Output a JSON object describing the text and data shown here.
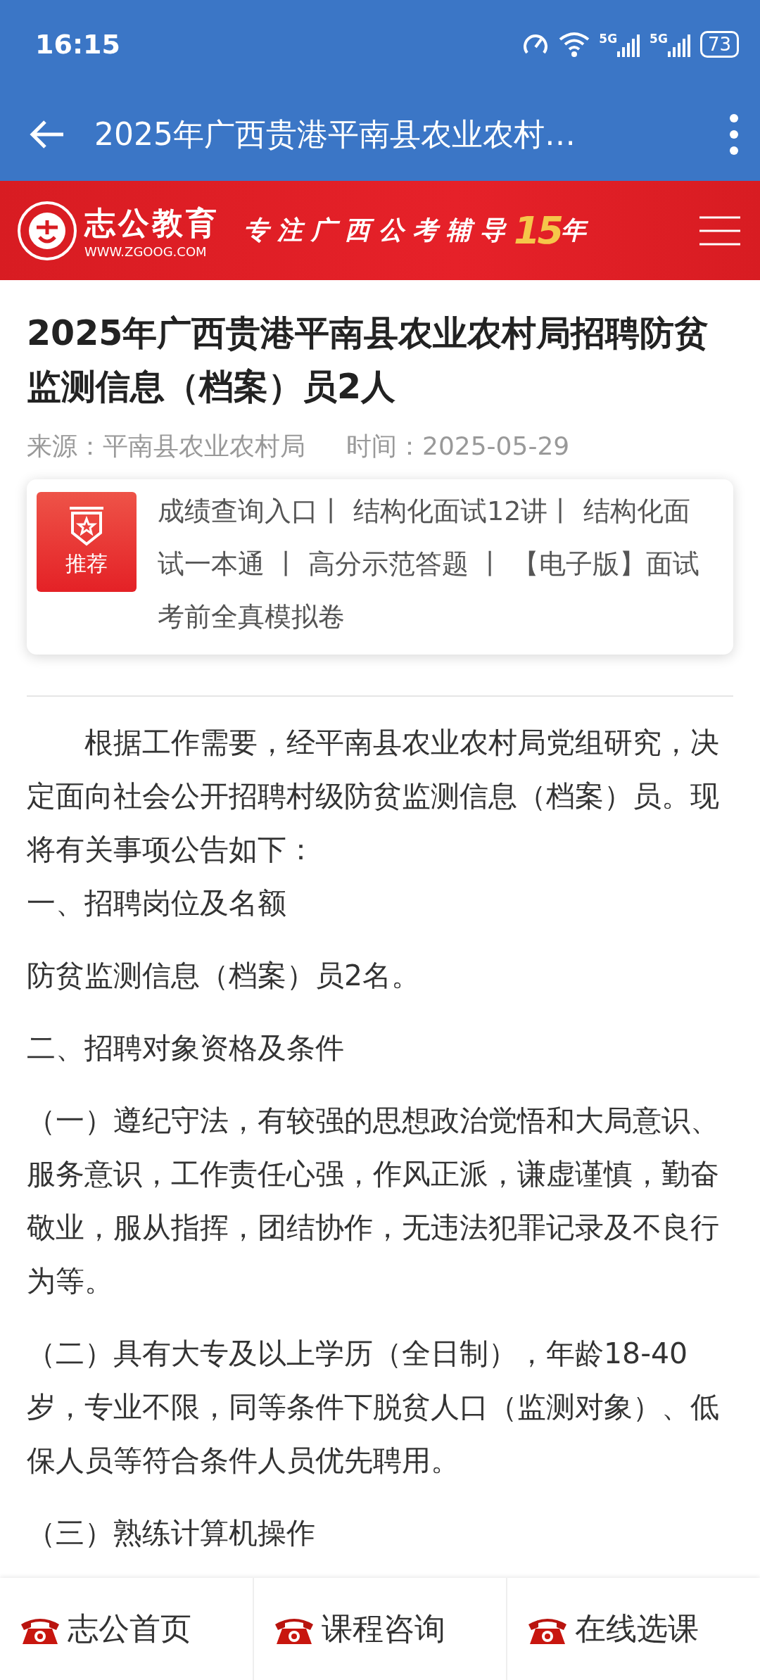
{
  "status_bar": {
    "time": "16:15",
    "network_1": "5G",
    "network_2": "5G",
    "battery": "73"
  },
  "app_bar": {
    "title": "2025年广西贵港平南县农业农村…"
  },
  "banner": {
    "brand": "志公教育",
    "url": "WWW.ZGOOG.COM",
    "slogan": "专注广西公考辅导",
    "slogan_number": "15",
    "slogan_end": "年"
  },
  "article": {
    "title": "2025年广西贵港平南县农业农村局招聘防贫监测信息（档案）员2人",
    "source": "来源：平南县农业农村局",
    "time": "时间：2025-05-29",
    "recommend": {
      "badge": "推荐",
      "text": " 成绩查询入口丨 结构化面试12讲丨 结构化面试一本通 丨 高分示范答题 丨 【电子版】面试考前全真模拟卷"
    },
    "paragraphs": [
      {
        "kind": "indent",
        "text": "根据工作需要，经平南县农业农村局党组研究，决定面向社会公开招聘村级防贫监测信息（档案）员。现将有关事项公告如下："
      },
      {
        "kind": "tight",
        "text": "一、招聘岗位及名额"
      },
      {
        "kind": "plain",
        "text": "防贫监测信息（档案）员2名。"
      },
      {
        "kind": "plain",
        "text": "二、招聘对象资格及条件"
      },
      {
        "kind": "plain",
        "text": "（一）遵纪守法，有较强的思想政治觉悟和大局意识、服务意识，工作责任心强，作风正派，谦虚谨慎，勤奋敬业，服从指挥，团结协作，无违法犯罪记录及不良行为等。"
      },
      {
        "kind": "plain",
        "text": "（二）具有大专及以上学历（全日制），年龄18-40岁，专业不限，同等条件下脱贫人口（监测对象）、低保人员等符合条件人员优先聘用。"
      },
      {
        "kind": "plain",
        "text": "（三）熟练计算机操作"
      }
    ]
  },
  "bottom_nav": [
    {
      "label": "志公首页"
    },
    {
      "label": "课程咨询"
    },
    {
      "label": "在线选课"
    }
  ]
}
